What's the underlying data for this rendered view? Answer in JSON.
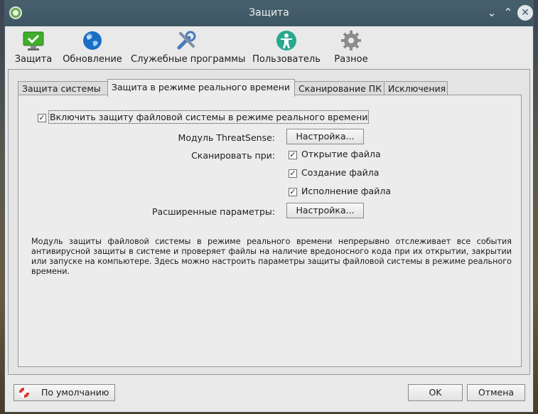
{
  "window": {
    "title": "Защита"
  },
  "toolbar": {
    "items": [
      {
        "label": "Защита",
        "icon": "monitor-check-icon"
      },
      {
        "label": "Обновление",
        "icon": "globe-icon"
      },
      {
        "label": "Служебные программы",
        "icon": "tools-icon"
      },
      {
        "label": "Пользователь",
        "icon": "user-icon"
      },
      {
        "label": "Разное",
        "icon": "gear-icon"
      }
    ]
  },
  "tabs": [
    {
      "label": "Защита системы",
      "active": false
    },
    {
      "label": "Защита в режиме реального времени",
      "active": true
    },
    {
      "label": "Сканирование ПК",
      "active": false
    },
    {
      "label": "Исключения",
      "active": false
    }
  ],
  "realtime": {
    "enable_label": "Включить защиту файловой системы в режиме реального времени",
    "enable_checked": true,
    "threatsense_label": "Модуль ThreatSense:",
    "setup_button": "Настройка...",
    "scan_on_label": "Сканировать при:",
    "scan_open_label": "Открытие файла",
    "scan_create_label": "Создание файла",
    "scan_exec_label": "Исполнение файла",
    "advanced_label": "Расширенные параметры:",
    "advanced_button": "Настройка...",
    "description": "Модуль защиты файловой системы в режиме реального времени непрерывно отслеживает все события антивирусной защиты в системе и проверяет файлы на наличие вредоносного кода при их открытии, закрытии или запуске на компьютере. Здесь можно настроить параметры защиты файловой системы в режиме реального времени."
  },
  "footer": {
    "default_button": "По умолчанию",
    "ok_button": "OK",
    "cancel_button": "Отмена"
  },
  "colors": {
    "titlebar": "#3e5663",
    "window_bg": "#e9e9e9",
    "accent_green": "#3fae2a",
    "globe_blue": "#1a6fc4"
  }
}
